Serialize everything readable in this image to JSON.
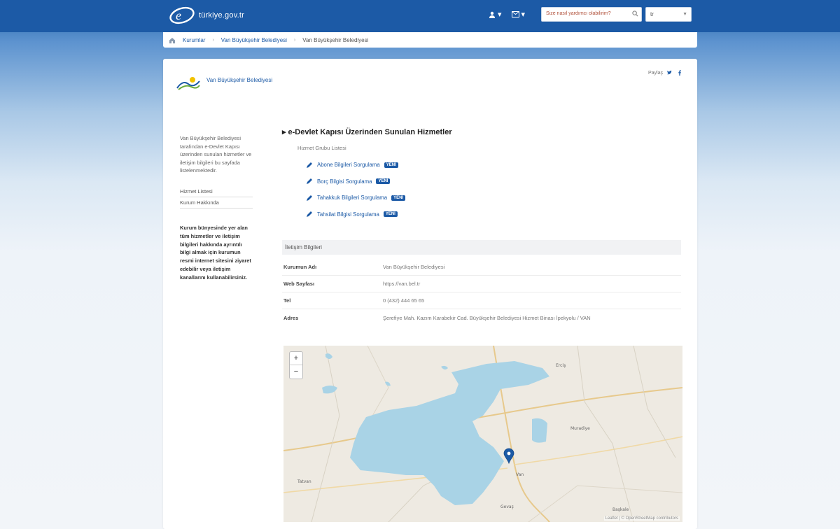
{
  "header": {
    "logo_text": "türkiye.gov.tr",
    "user_icon_label": "",
    "mail_icon_label": "",
    "search_placeholder": "Size nasıl yardımcı olabilirim?",
    "language": "tr"
  },
  "breadcrumb": {
    "items": [
      "Kurumlar",
      "Van Büyükşehir Belediyesi",
      "Van Büyükşehir Belediyesi"
    ]
  },
  "institution": {
    "name": "Van Büyükşehir Belediyesi",
    "share_label": "Paylaş"
  },
  "sidebar": {
    "description": "Van Büyükşehir Belediyesi tarafından e-Devlet Kapısı üzerinden sunulan hizmetler ve iletişim bilgileri bu sayfada listelenmektedir.",
    "links": [
      "Hizmet Listesi",
      "Kurum Hakkında"
    ],
    "note": "Kurum bünyesinde yer alan tüm hizmetler ve iletişim bilgileri hakkında ayrıntılı bilgi almak için kurumun resmi internet sitesini ziyaret edebilir veya iletişim kanallarını kullanabilirsiniz."
  },
  "services": {
    "title": "e-Devlet Kapısı Üzerinden Sunulan Hizmetler",
    "subtitle": "Hizmet Grubu Listesi",
    "items": [
      {
        "label": "Abone Bilgileri Sorgulama",
        "badge": "YENİ"
      },
      {
        "label": "Borç Bilgisi Sorgulama",
        "badge": "YENİ"
      },
      {
        "label": "Tahakkuk Bilgileri Sorgulama",
        "badge": "YENİ"
      },
      {
        "label": "Tahsilat Bilgisi Sorgulama",
        "badge": "YENİ"
      }
    ]
  },
  "contact": {
    "heading": "İletişim Bilgileri",
    "rows": [
      {
        "key": "Kurumun Adı",
        "value": "Van Büyükşehir Belediyesi"
      },
      {
        "key": "Web Sayfası",
        "value": "https://van.bel.tr"
      },
      {
        "key": "Tel",
        "value": "0 (432) 444 65 65"
      },
      {
        "key": "Adres",
        "value": "Şerefiye Mah. Kazım Karabekir Cad. Büyükşehir Belediyesi Hizmet Binası İpekyolu / VAN"
      }
    ]
  },
  "map": {
    "zoom_in": "+",
    "zoom_out": "−",
    "attribution": "Leaflet | © OpenStreetMap contributors",
    "labels": [
      "Erciş",
      "Muradiye",
      "Van",
      "Gevaş",
      "Tatvan",
      "Başkale"
    ]
  },
  "colors": {
    "header_blue": "#1c5aa6",
    "lake": "#a9d3e6",
    "badge": "#1c5aa6"
  }
}
